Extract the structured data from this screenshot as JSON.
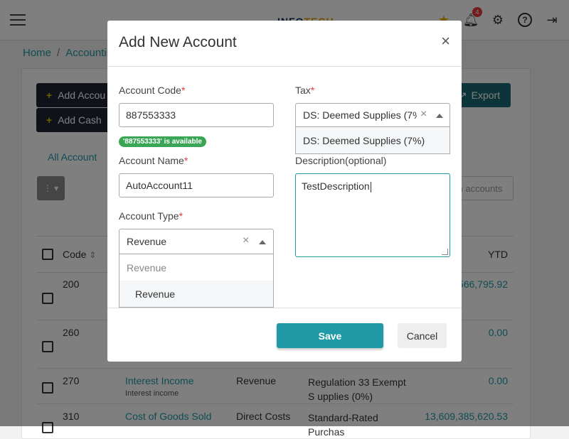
{
  "app": {
    "logo_part1": "INFO",
    "logo_part2": "TECH",
    "notification_count": "4"
  },
  "breadcrumb": {
    "home": "Home",
    "separator": "/",
    "current": "Accountin"
  },
  "toolbar": {
    "add_account": "Add Accou",
    "add_cash": "Add Cash",
    "export": "Export",
    "tab_all": "All Account",
    "search_placeholder": "ch accounts"
  },
  "table": {
    "headers": {
      "code": "Code",
      "ytd": "YTD"
    },
    "rows": [
      {
        "code": "200",
        "name": "",
        "sub": "",
        "type": "",
        "tax": "",
        "ytd": "566,795.92"
      },
      {
        "code": "260",
        "name": "",
        "sub": "",
        "type": "",
        "tax": "",
        "ytd": "0.00"
      },
      {
        "code": "270",
        "name": "Interest Income",
        "sub": "Interest income",
        "type": "Revenue",
        "tax": "Regulation 33 Exempt S upplies (0%)",
        "ytd": "0.00"
      },
      {
        "code": "310",
        "name": "Cost of Goods Sold",
        "sub": "",
        "type": "Direct Costs",
        "tax": "Standard-Rated Purchas",
        "ytd": "13,609,385,620.53"
      }
    ]
  },
  "modal": {
    "title": "Add New Account",
    "close": "×",
    "account_code": {
      "label": "Account Code",
      "required": "*",
      "value": "887553333",
      "availability": "'887553333' is available"
    },
    "tax": {
      "label": "Tax",
      "required": "*",
      "value": "DS: Deemed Supplies (7%)",
      "options": [
        "DS: Deemed Supplies (7%)"
      ]
    },
    "account_name": {
      "label": "Account Name",
      "required": "*",
      "value": "AutoAccount11"
    },
    "description": {
      "label": "Description(optional)",
      "value": "TestDescription"
    },
    "account_type": {
      "label": "Account Type",
      "required": "*",
      "value": "Revenue",
      "group_label": "Revenue",
      "options": [
        "Revenue"
      ]
    },
    "save": "Save",
    "cancel": "Cancel"
  },
  "colors": {
    "accent": "#1f9aa6",
    "success": "#3aa655",
    "required": "#e23b3b",
    "dark": "#1f2733"
  }
}
